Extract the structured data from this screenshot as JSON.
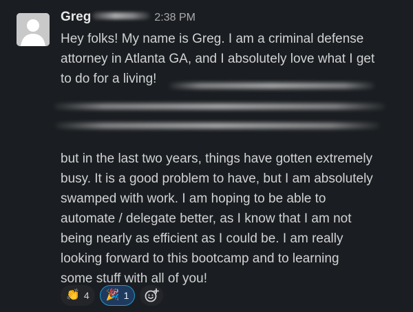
{
  "message": {
    "sender": "Greg",
    "timestamp": "2:38 PM",
    "lines_before": [
      "Hey folks! My name is Greg. I am a criminal defense",
      "attorney in Atlanta GA, and I absolutely love what I get",
      "to do for a living!"
    ],
    "lines_after": [
      "but in the last two years, things have gotten extremely",
      "busy. It is a good problem to have, but I am absolutely",
      "swamped with work. I am hoping to be able to",
      "automate / delegate better, as I know that I am not",
      "being nearly as efficient as I could be. I am really",
      "looking forward to this bootcamp and to learning",
      "some stuff with all of you!"
    ]
  },
  "reactions": [
    {
      "emoji": "👏",
      "icon": "clapping-hands-icon",
      "count": "4",
      "active": false
    },
    {
      "emoji": "🎉",
      "icon": "party-popper-icon",
      "count": "1",
      "active": true
    }
  ],
  "add_reaction_icon": "add-reaction-icon",
  "colors": {
    "background": "#1a1d21",
    "text": "#d1d2d3",
    "timestamp": "#ababad",
    "active_reaction_border": "#1d9bd1",
    "active_reaction_bg": "#1e3a5f"
  }
}
